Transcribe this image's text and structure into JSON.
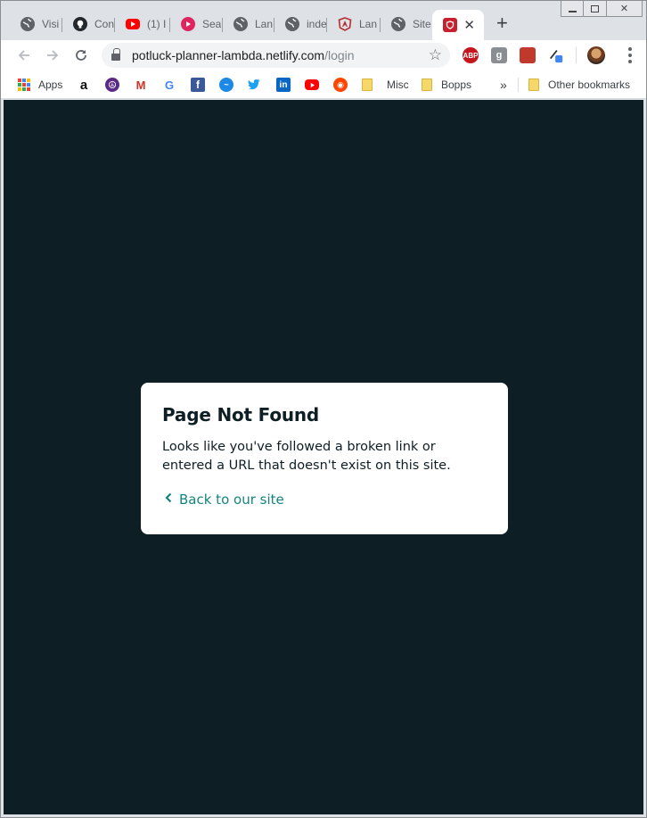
{
  "window": {
    "controls": [
      "minimize",
      "restore",
      "close"
    ]
  },
  "tabs": [
    {
      "title": "Visi",
      "icon": "globe-icon"
    },
    {
      "title": "Con",
      "icon": "github-icon"
    },
    {
      "title": "(1) I",
      "icon": "youtube-icon"
    },
    {
      "title": "Sea",
      "icon": "music-icon"
    },
    {
      "title": "Lan",
      "icon": "globe-icon"
    },
    {
      "title": "inde",
      "icon": "globe-icon"
    },
    {
      "title": "Lan",
      "icon": "angular-icon"
    },
    {
      "title": "Site",
      "icon": "globe-icon"
    },
    {
      "title": "",
      "icon": "netlify-shield-icon",
      "active": true
    }
  ],
  "toolbar": {
    "url_host": "potluck-planner-lambda.netlify.com",
    "url_path": "/login"
  },
  "bookmarks": {
    "items": [
      {
        "label": "Apps",
        "icon": "apps-grid-icon"
      },
      {
        "label": "",
        "icon": "amazon-icon"
      },
      {
        "label": "",
        "icon": "peace-icon"
      },
      {
        "label": "",
        "icon": "gmail-icon"
      },
      {
        "label": "",
        "icon": "google-icon"
      },
      {
        "label": "",
        "icon": "facebook-icon"
      },
      {
        "label": "",
        "icon": "messenger-icon"
      },
      {
        "label": "",
        "icon": "twitter-icon"
      },
      {
        "label": "",
        "icon": "linkedin-icon"
      },
      {
        "label": "",
        "icon": "youtube-icon"
      },
      {
        "label": "",
        "icon": "reddit-icon"
      },
      {
        "label": "Misc",
        "icon": "folder-icon"
      },
      {
        "label": "Bopps",
        "icon": "folder-icon"
      }
    ],
    "overflow": "»",
    "other": "Other bookmarks"
  },
  "page": {
    "heading": "Page Not Found",
    "message": "Looks like you've followed a broken link or entered a URL that doesn't exist on this site.",
    "back_link": "Back to our site"
  },
  "colors": {
    "page_bg": "#0e1e25",
    "card_bg": "#ffffff",
    "link": "#15847d"
  }
}
